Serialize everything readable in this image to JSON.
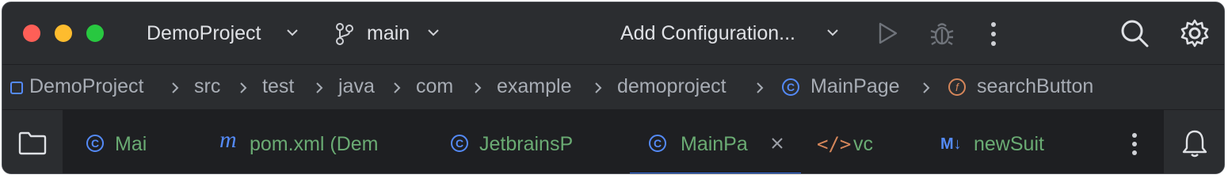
{
  "titlebar": {
    "project": "DemoProject",
    "branch": "main",
    "run_config": "Add Configuration..."
  },
  "breadcrumbs": [
    {
      "label": "DemoProject"
    },
    {
      "label": "src"
    },
    {
      "label": "test"
    },
    {
      "label": "java"
    },
    {
      "label": "com"
    },
    {
      "label": "example"
    },
    {
      "label": "demoproject"
    },
    {
      "label": "MainPage",
      "icon": "class-icon"
    },
    {
      "label": "searchButton",
      "icon": "field-icon"
    }
  ],
  "tabs": [
    {
      "label": "Mai",
      "icon": "class-icon"
    },
    {
      "label": "pom.xml (Dem",
      "icon": "maven-icon"
    },
    {
      "label": "JetbrainsP",
      "icon": "class-icon"
    },
    {
      "label": "MainPa",
      "icon": "class-icon",
      "active": true
    },
    {
      "label": "vc",
      "icon": "html-icon"
    },
    {
      "label": "newSuit",
      "icon": "markdown-icon",
      "icon_text": "M↓"
    }
  ],
  "colors": {
    "accent": "#3574f0",
    "tab_text": "#6aab73",
    "background": "#2b2d30"
  }
}
